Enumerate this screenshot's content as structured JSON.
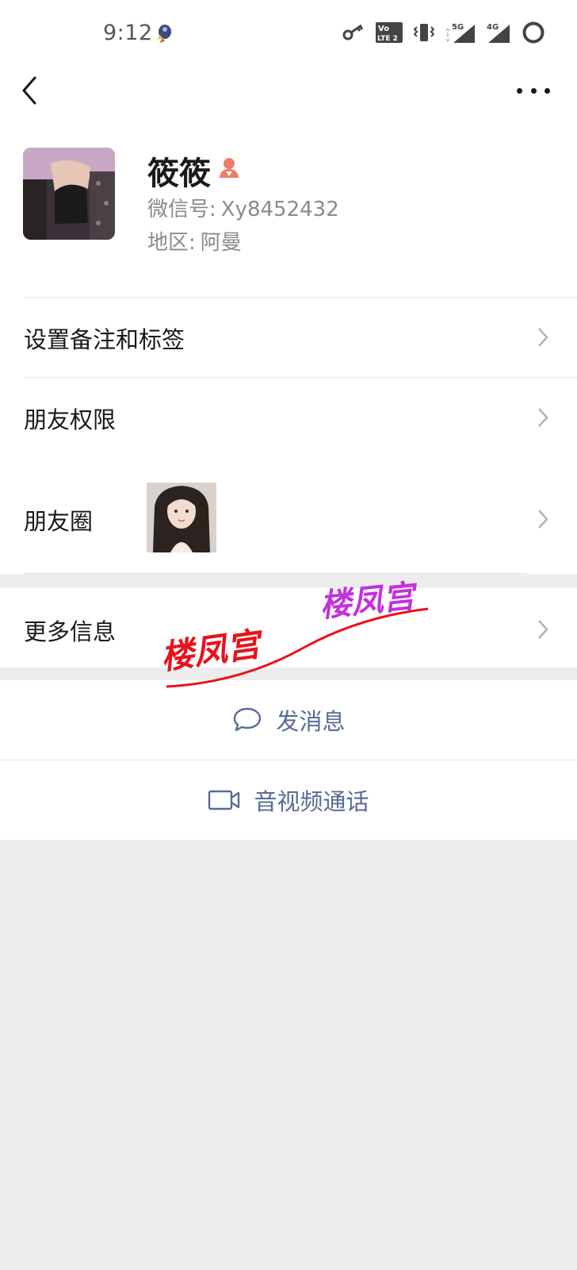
{
  "status_bar": {
    "time": "9:12",
    "icons": [
      "key-icon",
      "volte-icon",
      "vibrate-icon",
      "signal-5g-icon",
      "signal-4g-icon",
      "battery-ring-icon"
    ],
    "network_labels": [
      "5G",
      "4G"
    ],
    "volte_text": [
      "Vo",
      "LTE 2"
    ]
  },
  "nav": {
    "back_icon": "chevron-left-icon",
    "more_icon": "more-dots-icon"
  },
  "profile": {
    "name": "筱筱",
    "gender_icon": "female-icon",
    "gender_color": "#f27b6a",
    "wechat_id_label": "微信号:",
    "wechat_id": "Xy8452432",
    "region_label": "地区:",
    "region": "阿曼"
  },
  "menu": {
    "items": [
      {
        "label": "设置备注和标签"
      },
      {
        "label": "朋友权限"
      },
      {
        "label": "朋友圈"
      },
      {
        "label": "更多信息"
      }
    ]
  },
  "actions": {
    "send_message": "发消息",
    "video_call": "音视频通话",
    "accent": "#576b95"
  },
  "watermark": {
    "text_1": "楼凤宫",
    "text_2": "楼凤宫",
    "color_1": "#e8121b",
    "color_2": "#c42fe0"
  }
}
